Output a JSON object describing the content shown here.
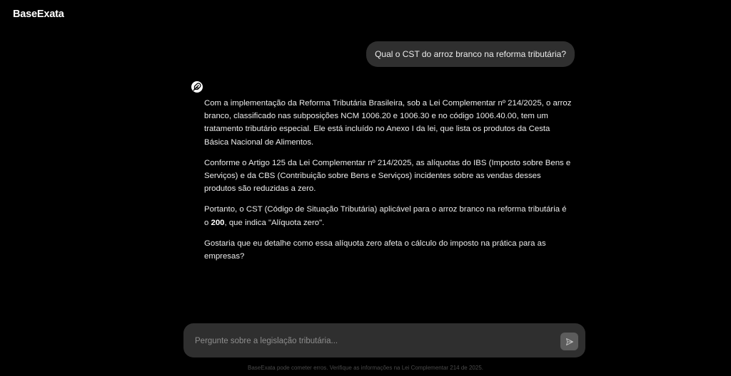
{
  "header": {
    "brand": "BaseExata"
  },
  "conversation": {
    "user_message": "Qual o CST do arroz branco na reforma tributária?",
    "assistant": {
      "icon": "feather-icon",
      "paragraphs": [
        "Com a implementação da Reforma Tributária Brasileira, sob a Lei Complementar nº 214/2025, o arroz branco, classificado nas subposições NCM 1006.20 e 1006.30 e no código 1006.40.00, tem um tratamento tributário especial. Ele está incluído no Anexo I da lei, que lista os produtos da Cesta Básica Nacional de Alimentos.",
        "Conforme o Artigo 125 da Lei Complementar nº 214/2025, as alíquotas do IBS (Imposto sobre Bens e Serviços) e da CBS (Contribuição sobre Bens e Serviços) incidentes sobre as vendas desses produtos são reduzidas a zero."
      ],
      "p3_before": "Portanto, o CST (Código de Situação Tributária) aplicável para o arroz branco na reforma tributária é o ",
      "p3_bold": "200",
      "p3_after": ", que indica \"Alíquota zero\".",
      "p4": "Gostaria que eu detalhe como essa alíquota zero afeta o cálculo do imposto na prática para as empresas?"
    }
  },
  "composer": {
    "placeholder": "Pergunte sobre a legislação tributária...",
    "value": "",
    "send_icon": "send-icon"
  },
  "footer": {
    "disclaimer": "BaseExata pode cometer erros. Verifique as informações na Lei Complementar 214 de 2025."
  },
  "colors": {
    "background": "#000000",
    "bubble": "#2f2f2f",
    "text": "#ececec",
    "placeholder": "#8e8e8e",
    "send_button": "#5c5c5c"
  }
}
